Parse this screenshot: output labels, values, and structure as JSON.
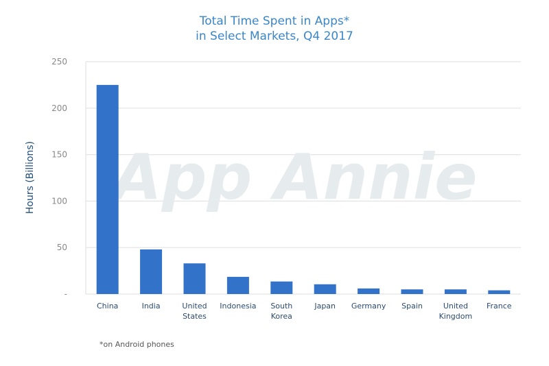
{
  "chart_data": {
    "type": "bar",
    "title": "Total Time Spent in Apps* in Select Markets, Q4 2017",
    "title_lines": [
      "Total Time Spent in Apps*",
      "in Select Markets, Q4 2017"
    ],
    "xlabel": "",
    "ylabel": "Hours (Billions)",
    "ylim": [
      0,
      250
    ],
    "yticks": [
      0,
      50,
      100,
      150,
      200,
      250
    ],
    "ytick_labels": [
      "-",
      "50",
      "100",
      "150",
      "200",
      "250"
    ],
    "grid": true,
    "categories": [
      [
        "China"
      ],
      [
        "India"
      ],
      [
        "United",
        "States"
      ],
      [
        "Indonesia"
      ],
      [
        "South",
        "Korea"
      ],
      [
        "Japan"
      ],
      [
        "Germany"
      ],
      [
        "Spain"
      ],
      [
        "United",
        "Kingdom"
      ],
      [
        "France"
      ]
    ],
    "category_names": [
      "China",
      "India",
      "United States",
      "Indonesia",
      "South Korea",
      "Japan",
      "Germany",
      "Spain",
      "United Kingdom",
      "France"
    ],
    "values": [
      225,
      48,
      33,
      18.5,
      13.5,
      10.5,
      6,
      5,
      5,
      4
    ],
    "bar_color": "#3272c8",
    "watermark": "App Annie",
    "footnote": "*on Android phones"
  }
}
